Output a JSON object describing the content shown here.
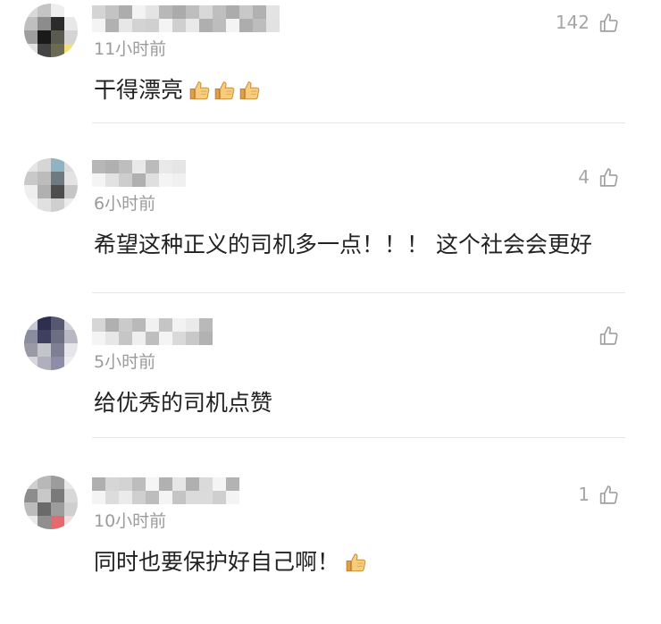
{
  "comments": [
    {
      "time": "11小时前",
      "text": "干得漂亮",
      "emoji": [
        "thumbs-up-emoji",
        "thumbs-up-emoji",
        "thumbs-up-emoji"
      ],
      "likes": "142",
      "like_icon": "thumbs-up-outline-icon"
    },
    {
      "time": "6小时前",
      "text": "希望这种正义的司机多一点！！！ 这个社会会更好",
      "emoji": [],
      "likes": "4",
      "like_icon": "thumbs-up-outline-icon"
    },
    {
      "time": "5小时前",
      "text": "给优秀的司机点赞",
      "emoji": [],
      "likes": "",
      "like_icon": "thumbs-up-outline-icon"
    },
    {
      "time": "10小时前",
      "text": "同时也要保护好自己啊！",
      "emoji": [
        "thumbs-up-emoji"
      ],
      "likes": "1",
      "like_icon": "thumbs-up-outline-icon"
    }
  ],
  "colors": {
    "text": "#222222",
    "meta": "#9b9b9b",
    "like": "#a6a6a6",
    "divider": "#e6e6e6",
    "background": "#ffffff"
  }
}
